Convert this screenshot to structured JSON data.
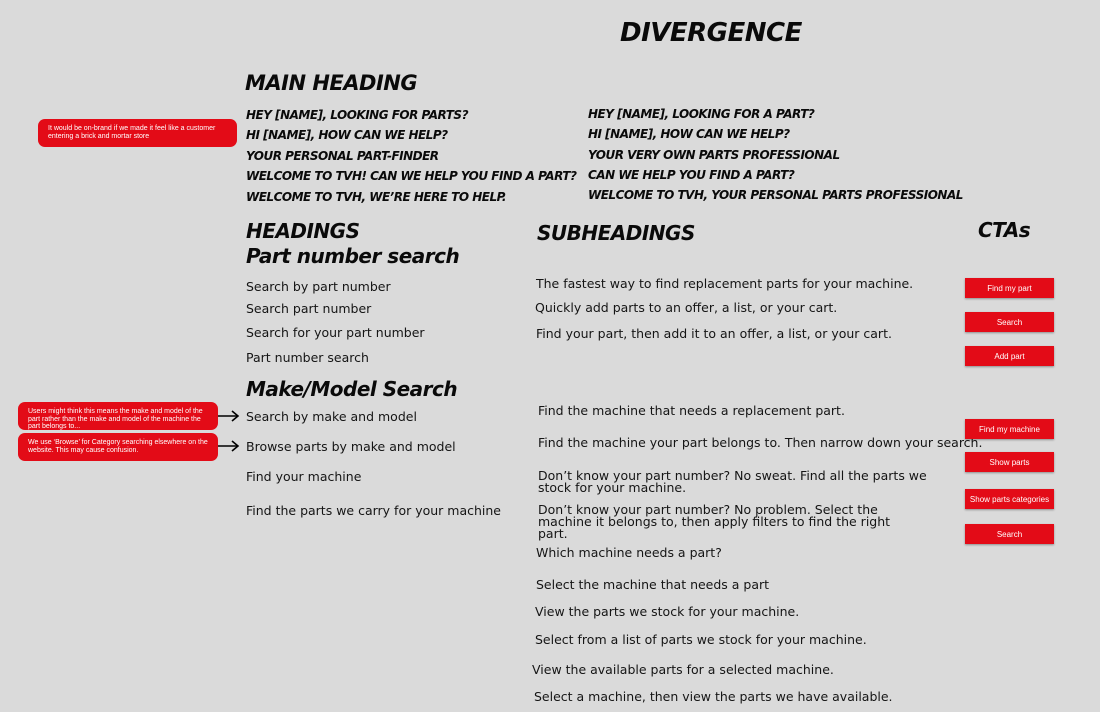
{
  "page": {
    "title": "DIVERGENCE",
    "main_heading": {
      "title": "MAIN HEADING",
      "left": [
        "HEY [NAME], LOOKING FOR PARTS?",
        "HI [NAME], HOW CAN WE HELP?",
        "YOUR PERSONAL PART-FINDER",
        "WELCOME TO TVH! CAN WE HELP YOU FIND A PART?",
        "WELCOME TO TVH, WE’RE HERE TO HELP."
      ],
      "right": [
        "HEY [NAME], LOOKING FOR A PART?",
        "HI [NAME], HOW CAN WE HELP?",
        "YOUR VERY OWN PARTS PROFESSIONAL",
        "CAN WE HELP YOU FIND A PART?",
        "WELCOME TO TVH, YOUR PERSONAL PARTS PROFESSIONAL"
      ]
    },
    "headings": {
      "title": "HEADINGS",
      "part_number": {
        "title": "Part number search",
        "items": [
          "Search by part number",
          "Search part number",
          "Search for your part number",
          "Part number search"
        ]
      },
      "make_model": {
        "title": "Make/Model Search",
        "items": [
          "Search by make and model",
          "Browse parts by make and model",
          "Find your machine",
          "Find the parts we carry for your machine"
        ]
      }
    },
    "subheadings": {
      "title": "SUBHEADINGS",
      "part_number": [
        "The fastest way to find replacement parts for your machine.",
        "Quickly add parts to an offer, a list, or your cart.",
        "Find your part, then add it to an offer, a list, or your cart."
      ],
      "make_model": [
        "Find the machine that needs a replacement part.",
        "Find the machine your part belongs to. Then narrow down your search.",
        "Don’t know your part number? No sweat. Find all the parts we stock for your machine.",
        "Don’t know your part number? No problem. Select the machine it belongs to, then apply filters to find the right part.",
        "Which machine needs a part?",
        "Select the machine that needs a part",
        "View the parts we stock for your machine.",
        "Select from a list of parts we stock for your machine.",
        "View the available parts for a selected machine.",
        "Select a machine, then view the parts we have available."
      ]
    },
    "ctas": {
      "title": "CTAs",
      "part_number": [
        "Find my part",
        "Search",
        "Add part"
      ],
      "make_model": [
        "Find my machine",
        "Show parts",
        "Show parts categories",
        "Search"
      ]
    },
    "notes": [
      "It would be on-brand if we made it feel like a customer entering a brick and mortar store",
      "Users might think this means the make and model of the part rather than the make and model of the machine the part belongs to...",
      "We use ‘Browse’ for Category searching elsewhere on the website. This may cause confusion."
    ],
    "colors": {
      "background": "#dadada",
      "accent": "#e30b17",
      "text": "#0a0a0a"
    }
  }
}
